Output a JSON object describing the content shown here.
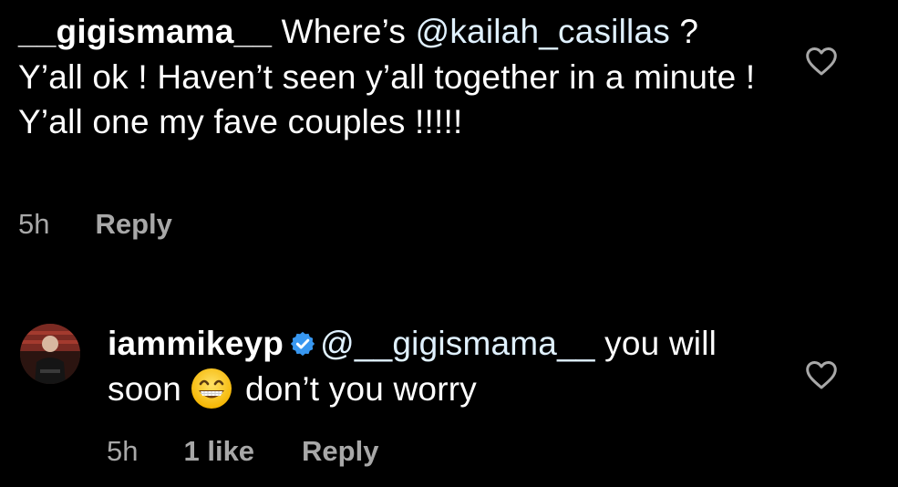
{
  "comments": [
    {
      "username": "__gigismama__",
      "text_before_mention": " Where’s ",
      "mention": "@kailah_casillas",
      "text_after_mention": " ? Y’all ok ! Haven’t seen y’all together in a minute ! Y’all one my fave couples !!!!!",
      "time": "5h",
      "reply_label": "Reply",
      "heart_icon": "heart-outline-icon"
    },
    {
      "username": "iammikeyp",
      "verified": true,
      "mention": "@__gigismama__",
      "text_before_emoji": " you will soon",
      "emoji": "grinning-face-with-smiling-eyes",
      "text_after_emoji": "don’t you worry",
      "time": "5h",
      "likes": "1 like",
      "reply_label": "Reply",
      "heart_icon": "heart-outline-icon"
    }
  ],
  "colors": {
    "background": "#000000",
    "text": "#ffffff",
    "mention": "#e0f1ff",
    "meta": "#a8a8a8",
    "verified_badge": "#3897f0"
  }
}
